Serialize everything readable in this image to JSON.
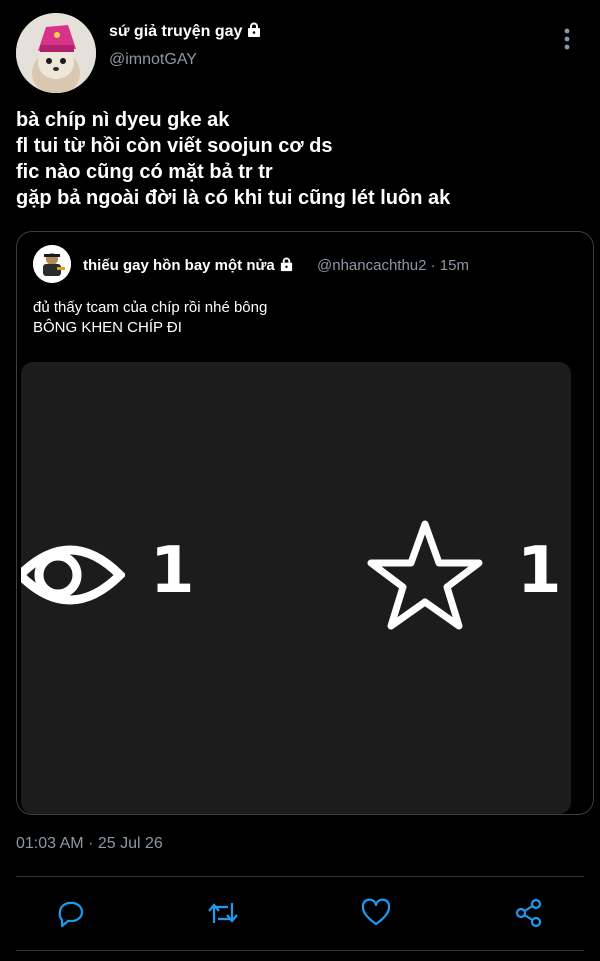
{
  "author": {
    "display_name": "sứ giả truyện gay",
    "handle": "@imnotGAY",
    "avatar": "chihuahua-pink-hat-avatar",
    "locked": true
  },
  "tweet": {
    "lines": [
      "bà chíp nì dyeu gke ak",
      "fl tui từ hồi còn viết soojun cơ ds",
      "fic nào cũng có mặt bả tr tr",
      "gặp bả ngoài đời là có khi tui cũng lét luôn ak"
    ],
    "timestamp": "01:03 AM · 25 Jul 26"
  },
  "quote": {
    "display_name": "thiếu gay hồn bay một nửa",
    "handle_time": "@nhancachthu2 · 15m",
    "locked": true,
    "lines": [
      "đủ thấy tcam của chíp rồi nhé bông",
      "BÔNG KHEN CHÍP ĐI"
    ],
    "media": {
      "views_icon": "eye-icon",
      "views": "1",
      "stars_icon": "star-icon",
      "stars": "1"
    }
  },
  "actions": [
    {
      "icon": "reply-icon"
    },
    {
      "icon": "retweet-icon"
    },
    {
      "icon": "like-icon"
    },
    {
      "icon": "share-icon"
    }
  ],
  "colors": {
    "background": "#000000",
    "text": "#ffffff",
    "secondary": "#8b98a5",
    "border": "#3a3f44",
    "media_bg": "#1c1c1c"
  }
}
